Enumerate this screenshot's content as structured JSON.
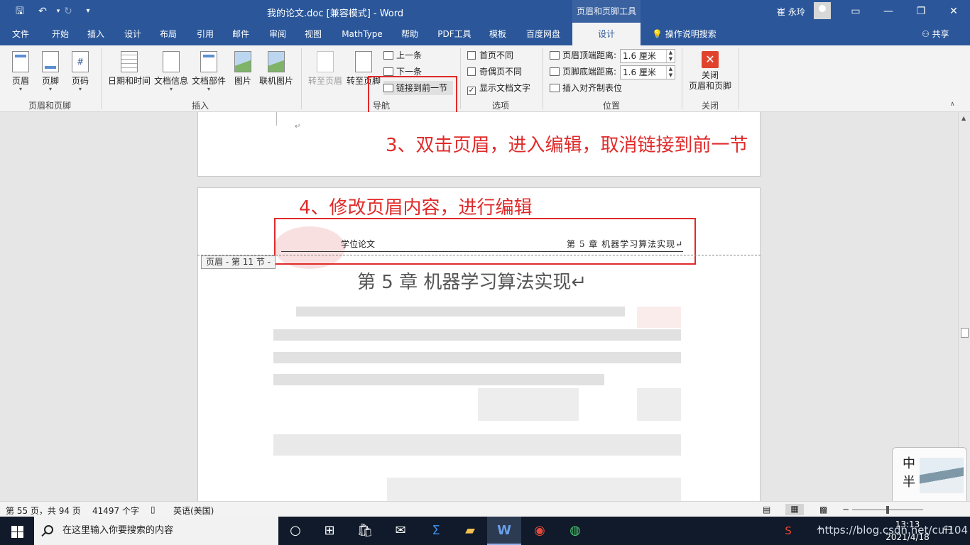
{
  "titlebar": {
    "doc_title": "我的论文.doc [兼容模式] - Word",
    "tools_tab": "页眉和页脚工具",
    "user": "崔 永玲",
    "save_icon": "save-icon",
    "undo_icon": "undo-icon",
    "redo_icon": "redo-icon"
  },
  "tabs": [
    "文件",
    "开始",
    "插入",
    "设计",
    "布局",
    "引用",
    "邮件",
    "审阅",
    "视图",
    "MathType",
    "帮助",
    "PDF工具",
    "模板",
    "百度网盘",
    "设计"
  ],
  "tellme": "操作说明搜索",
  "share": "共享",
  "ribbon": {
    "header": "页眉",
    "footer": "页脚",
    "page_number": "页码",
    "group_header_footer": "页眉和页脚",
    "date_time": "日期和时间",
    "doc_info": "文档信息",
    "doc_parts": "文档部件",
    "picture": "图片",
    "online_picture": "联机图片",
    "group_insert": "插入",
    "goto_header": "转至页眉",
    "goto_footer": "转至页脚",
    "prev": "上一条",
    "next": "下一条",
    "link_prev": "链接到前一节",
    "group_nav": "导航",
    "diff_first": "首页不同",
    "diff_odd_even": "奇偶页不同",
    "show_doc_text": "显示文档文字",
    "group_options": "选项",
    "header_top_label": "页眉顶端距离:",
    "header_top_value": "1.6 厘米",
    "footer_bottom_label": "页脚底端距离:",
    "footer_bottom_value": "1.6 厘米",
    "insert_align_tab": "插入对齐制表位",
    "group_position": "位置",
    "close_line1": "关闭",
    "close_line2": "页眉和页脚",
    "group_close": "关闭"
  },
  "document": {
    "annotation_3": "3、双击页眉，进入编辑，取消链接到前一节",
    "annotation_4": "4、修改页眉内容，进行编辑",
    "header_left": "学位论文",
    "header_right": "第 5 章  机器学习算法实现↵",
    "section_tag": "页眉 - 第 11 节 -",
    "chapter_title": "第 5 章  机器学习算法实现↵",
    "para_mark": "↵"
  },
  "thumbnail": {
    "text": "中 半 。"
  },
  "statusbar": {
    "page_info": "第 55 页，共 94 页",
    "word_count": "41497 个字",
    "language": "英语(美国)"
  },
  "taskbar": {
    "search_placeholder": "在这里输入你要搜索的内容",
    "watermark": "https://blog.csdn.net/cui104",
    "time": "13:13",
    "date": "2021/4/18"
  }
}
